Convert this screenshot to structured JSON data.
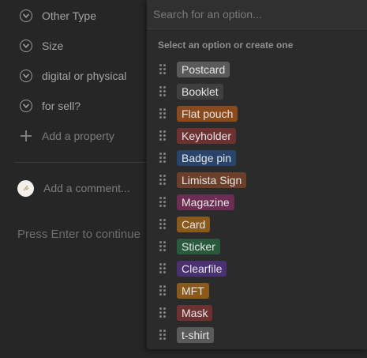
{
  "properties": [
    {
      "label": "Other Type"
    },
    {
      "label": "Size"
    },
    {
      "label": "digital or physical"
    },
    {
      "label": "for sell?"
    }
  ],
  "add_property_label": "Add a property",
  "comment_placeholder": "Add a comment...",
  "press_enter_text": "Press Enter to continue",
  "dropdown": {
    "search_placeholder": "Search for an option...",
    "section_label": "Select an option or create one",
    "options": [
      {
        "label": "Postcard",
        "color": "#5a5a5a"
      },
      {
        "label": "Booklet",
        "color": "#3f3f3f"
      },
      {
        "label": "Flat pouch",
        "color": "#8a4a1c"
      },
      {
        "label": "Keyholder",
        "color": "#6e3131"
      },
      {
        "label": "Badge pin",
        "color": "#28446b"
      },
      {
        "label": "Limista Sign",
        "color": "#6b3f2a"
      },
      {
        "label": "Magazine",
        "color": "#6b2e52"
      },
      {
        "label": "Card",
        "color": "#8a5a1c"
      },
      {
        "label": "Sticker",
        "color": "#2a5a3e"
      },
      {
        "label": "Clearfile",
        "color": "#4b3172"
      },
      {
        "label": "MFT",
        "color": "#8a5a1c"
      },
      {
        "label": "Mask",
        "color": "#6e3131"
      },
      {
        "label": "t-shirt",
        "color": "#5a5a5a"
      }
    ]
  }
}
